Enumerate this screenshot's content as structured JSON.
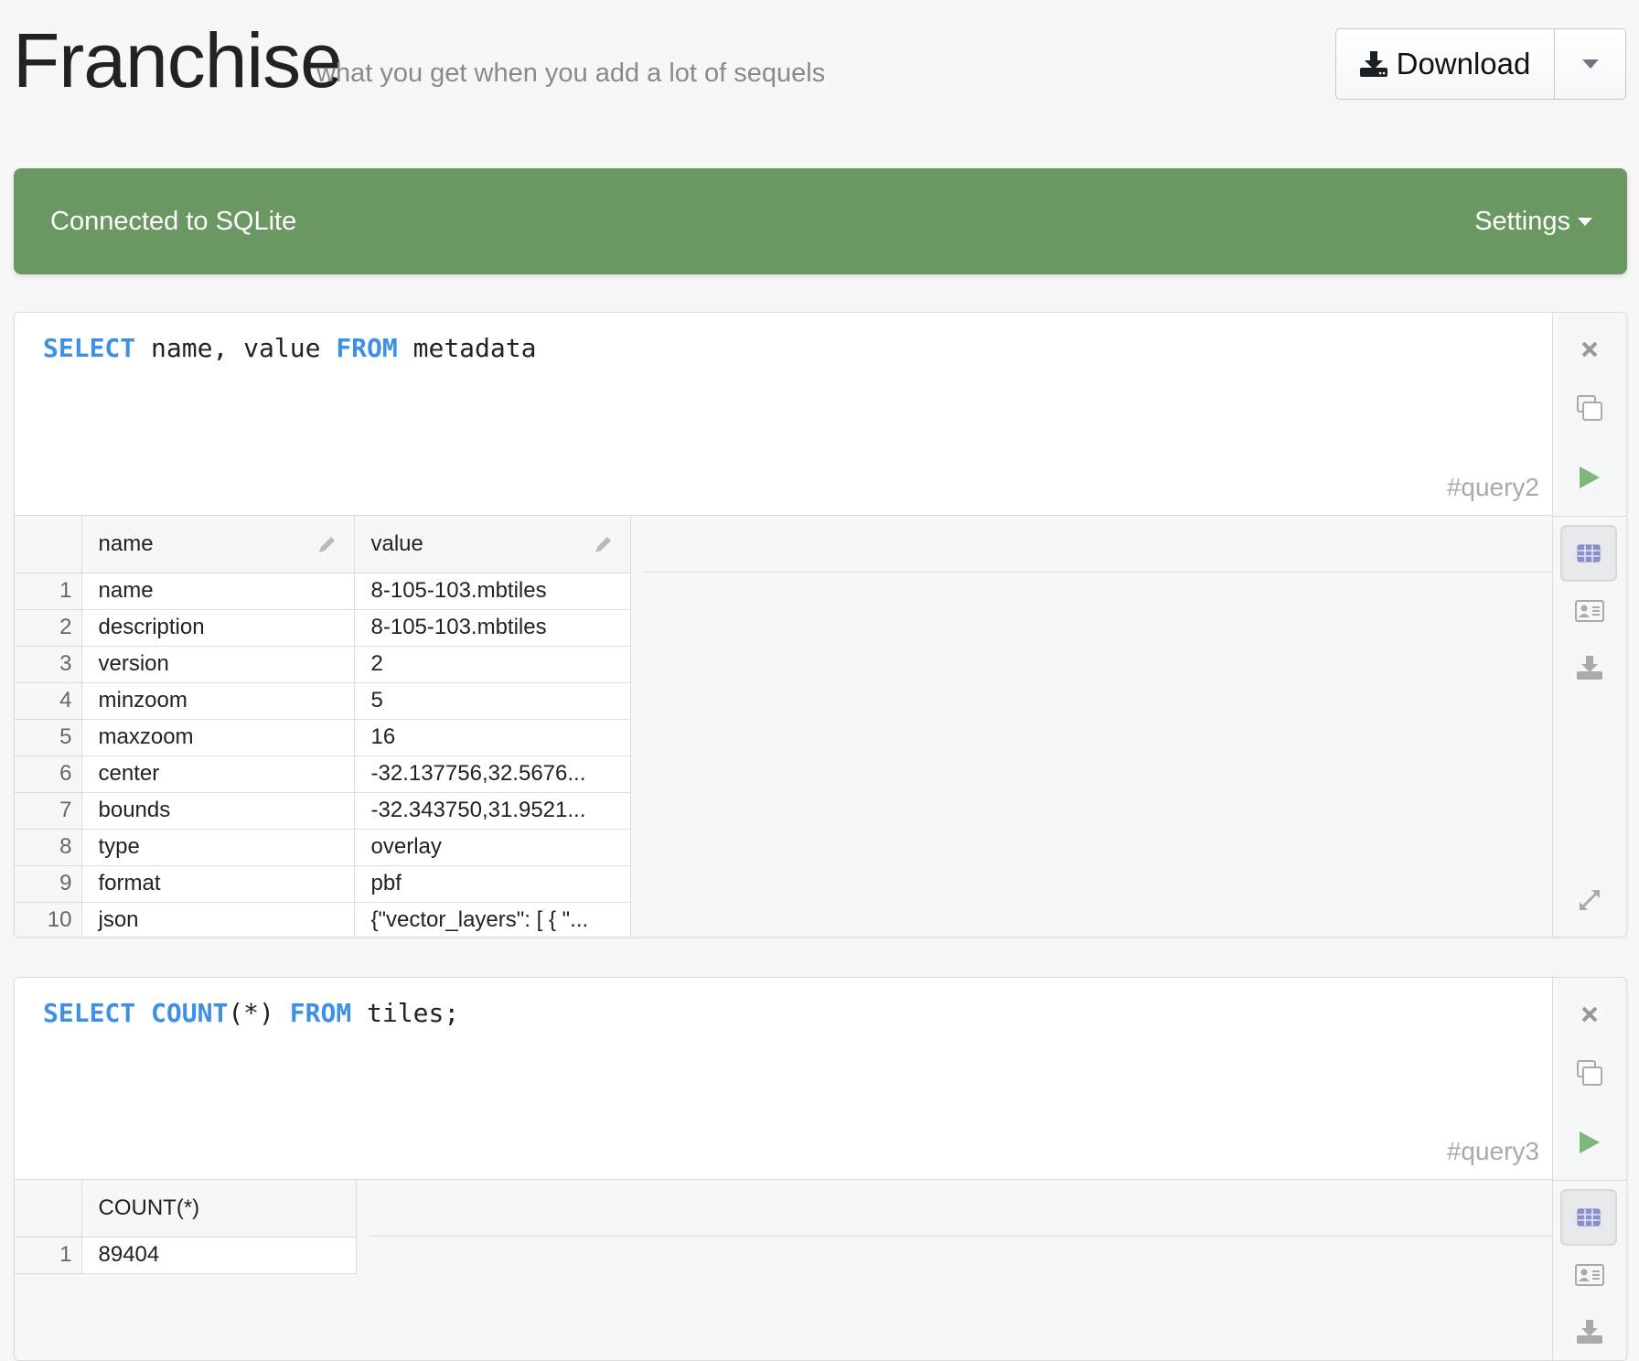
{
  "header": {
    "title": "Franchise",
    "subtitle": "what you get when you add a lot of sequels",
    "download_label": "Download"
  },
  "status": {
    "text": "Connected to SQLite",
    "settings_label": "Settings",
    "color": "#6b9763"
  },
  "queries": [
    {
      "code": {
        "k1": "SELECT",
        "t1": " name, value ",
        "k2": "FROM",
        "t2": " metadata"
      },
      "label": "#query2",
      "columns": [
        "name",
        "value"
      ],
      "rows": [
        [
          "1",
          "name",
          "8-105-103.mbtiles"
        ],
        [
          "2",
          "description",
          "8-105-103.mbtiles"
        ],
        [
          "3",
          "version",
          "2"
        ],
        [
          "4",
          "minzoom",
          "5"
        ],
        [
          "5",
          "maxzoom",
          "16"
        ],
        [
          "6",
          "center",
          "-32.137756,32.5676..."
        ],
        [
          "7",
          "bounds",
          "-32.343750,31.9521..."
        ],
        [
          "8",
          "type",
          "overlay"
        ],
        [
          "9",
          "format",
          "pbf"
        ],
        [
          "10",
          "json",
          "{\"vector_layers\": [ { \"..."
        ]
      ]
    },
    {
      "code": {
        "k1": "SELECT",
        "k2": "COUNT",
        "t1": "(*) ",
        "k3": "FROM",
        "t2": " tiles;"
      },
      "label": "#query3",
      "columns": [
        "COUNT(*)"
      ],
      "rows": [
        [
          "1",
          "89404"
        ]
      ]
    }
  ],
  "colors": {
    "keyword": "#3d8fe8",
    "run": "#7cb87a",
    "active_view": "#7b7fc4"
  }
}
